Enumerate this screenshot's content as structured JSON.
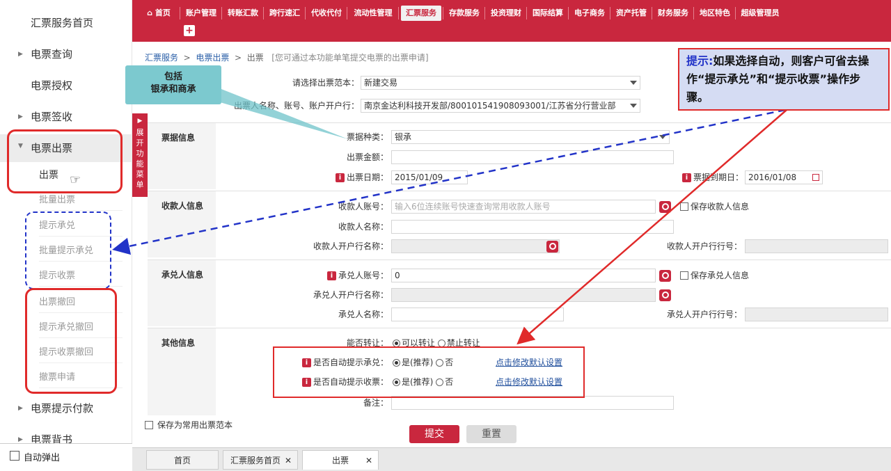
{
  "sidebar": {
    "items": [
      {
        "label": "汇票服务首页"
      },
      {
        "label": "电票查询"
      },
      {
        "label": "电票授权"
      },
      {
        "label": "电票签收"
      },
      {
        "label": "电票出票"
      },
      {
        "label": "电票提示付款"
      },
      {
        "label": "电票背书"
      }
    ],
    "sub_items": [
      "出票",
      "批量出票",
      "提示承兑",
      "批量提示承兑",
      "提示收票",
      "出票撤回",
      "提示承兑撤回",
      "提示收票撤回",
      "撤票申请"
    ],
    "auto_popup": "自动弹出",
    "toggle": "展开功能菜单"
  },
  "topnav": {
    "home": "首页",
    "items": [
      "账户管理",
      "转账汇款",
      "跨行速汇",
      "代收代付",
      "流动性管理",
      "汇票服务",
      "存款服务",
      "投资理财",
      "国际结算",
      "电子商务",
      "资产托管",
      "财务服务",
      "地区特色",
      "超级管理员"
    ],
    "selected": "汇票服务"
  },
  "breadcrumb": {
    "a": "汇票服务",
    "b": "电票出票",
    "c": "出票",
    "sep": ">",
    "hint": "[您可通过本功能单笔提交电票的出票申请]"
  },
  "form": {
    "template_label": "请选择出票范本：",
    "template_value": "新建交易",
    "account_label": "出票人名称、账号、账户开户行：",
    "account_value": "南京金达利科技开发部/800101541908093001/江苏省分行营业部",
    "sec_bill": "票据信息",
    "bill_type_label": "票据种类：",
    "bill_type_value": "银承",
    "amount_label": "出票金额：",
    "issue_date_label": "出票日期：",
    "issue_date_value": "2015/01/09",
    "due_date_label": "票据到期日：",
    "due_date_value": "2016/01/08",
    "sec_payee": "收款人信息",
    "payee_acct_label": "收款人账号：",
    "payee_acct_placeholder": "输入6位连续账号快速查询常用收款人账号",
    "save_payee": "保存收款人信息",
    "payee_name_label": "收款人名称：",
    "payee_bank_label": "收款人开户行名称：",
    "payee_bank_no_label": "收款人开户行行号：",
    "sec_acceptor": "承兑人信息",
    "acc_acct_label": "承兑人账号：",
    "acc_acct_value": "0",
    "save_acceptor": "保存承兑人信息",
    "acc_bank_label": "承兑人开户行名称：",
    "acc_name_label": "承兑人名称：",
    "acc_bank_no_label": "承兑人开户行行号：",
    "sec_other": "其他信息",
    "transfer_label": "能否转让：",
    "transfer_yes": "可以转让",
    "transfer_no": "禁止转让",
    "auto_accept_label": "是否自动提示承兑：",
    "auto_receive_label": "是否自动提示收票：",
    "yes_rec": "是(推荐)",
    "no": "否",
    "edit_default": "点击修改默认设置",
    "remark_label": "备注：",
    "save_template": "保存为常用出票范本",
    "submit": "提交",
    "reset": "重置"
  },
  "annotations": {
    "teal_box_line1": "包括",
    "teal_box_line2": "银承和商承",
    "tip_label": "提示:",
    "tip_text": "如果选择自动，则客户可省去操作“提示承兑”和“提示收票”操作步骤。"
  },
  "footer_tabs": [
    "首页",
    "汇票服务首页",
    "出票"
  ],
  "colors": {
    "brand": "#c9273e",
    "annotation_red": "#e02a2a",
    "annotation_blue": "#2233c8",
    "teal": "#6fc3c9",
    "tip_bg": "#d5dcf3"
  }
}
